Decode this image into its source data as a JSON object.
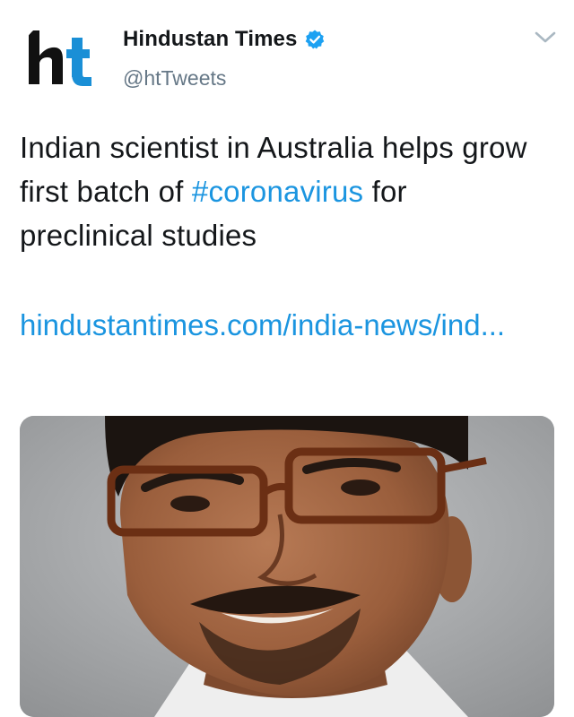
{
  "author": {
    "display_name": "Hindustan Times",
    "handle": "@htTweets",
    "avatar_text": "ht",
    "verified": true,
    "verified_color": "#1da1f2",
    "avatar_icon": "ht-logo-icon"
  },
  "tweet": {
    "text_before": "Indian scientist in Australia helps grow first batch of ",
    "hashtag": "#coronavirus",
    "text_after": " for preclinical studies",
    "link_text": "hindustantimes.com/india-news/ind..."
  },
  "media": {
    "description_icon": "photo-of-scientist-icon"
  },
  "colors": {
    "link": "#1b95e0",
    "text": "#14171a",
    "secondary": "#657786",
    "logo_blue": "#1a8fd6"
  },
  "menu_icon": "chevron-down-icon"
}
